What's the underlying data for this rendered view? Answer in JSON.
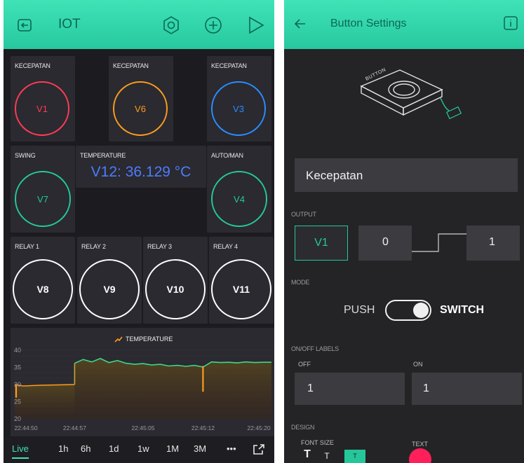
{
  "left": {
    "header": {
      "title": "IOT"
    },
    "widgets": [
      {
        "id": "kec1",
        "label": "KECEPATAN",
        "pin": "V1",
        "color": "#ff3b55"
      },
      {
        "id": "kec2",
        "label": "KECEPATAN",
        "pin": "V6",
        "color": "#ff9a1f"
      },
      {
        "id": "kec3",
        "label": "KECEPATAN",
        "pin": "V3",
        "color": "#2a8cff"
      },
      {
        "id": "swing",
        "label": "SWING",
        "pin": "V7",
        "color": "#25c79a"
      },
      {
        "id": "automan",
        "label": "AUTO/MAN",
        "pin": "V4",
        "color": "#25c79a"
      },
      {
        "id": "r1",
        "label": "RELAY 1",
        "pin": "V8",
        "color": "#ffffff"
      },
      {
        "id": "r2",
        "label": "RELAY 2",
        "pin": "V9",
        "color": "#ffffff"
      },
      {
        "id": "r3",
        "label": "RELAY 3",
        "pin": "V10",
        "color": "#ffffff"
      },
      {
        "id": "r4",
        "label": "RELAY 4",
        "pin": "V11",
        "color": "#ffffff"
      }
    ],
    "temperature_display": {
      "label": "TEMPERATURE",
      "value": "V12: 36.129 °C",
      "color": "#4d7bff"
    },
    "chart_data": {
      "type": "line",
      "title": "TEMPERATURE",
      "x_tick_labels": [
        "22:44:50",
        "22:44:57",
        "22:45:05",
        "22:45:12",
        "22:45:20"
      ],
      "y_tick_labels": [
        "20",
        "25",
        "30",
        "35",
        "40"
      ],
      "ylim": [
        20,
        40
      ],
      "series": [
        {
          "color": "#ff9a1f",
          "x": [
            "22:44:50",
            "22:44:51",
            "22:44:53",
            "22:44:55",
            "22:44:57"
          ],
          "y": [
            30,
            29.6,
            29.8,
            29.9,
            30
          ]
        },
        {
          "color": "#3fd68a",
          "x": [
            "22:44:57",
            "22:44:58",
            "22:44:59",
            "22:45:00",
            "22:45:01",
            "22:45:02",
            "22:45:03",
            "22:45:04",
            "22:45:05",
            "22:45:06",
            "22:45:07",
            "22:45:08",
            "22:45:09",
            "22:45:10",
            "22:45:11",
            "22:45:12",
            "22:45:13",
            "22:45:14",
            "22:45:15",
            "22:45:16",
            "22:45:17",
            "22:45:18",
            "22:45:19",
            "22:45:20"
          ],
          "y": [
            36.2,
            37.3,
            36.6,
            37.6,
            36.4,
            37.0,
            36.2,
            35.9,
            36.1,
            35.7,
            35.9,
            35.4,
            35.6,
            35.3,
            35.6,
            35.1,
            36.6,
            36.4,
            36.5,
            36.3,
            36.6,
            36.4,
            36.5,
            36.5
          ]
        }
      ],
      "dips": [
        {
          "x": "22:44:50",
          "y": 26.2
        },
        {
          "x": "22:45:12",
          "y": 27.9
        }
      ]
    },
    "ranges": [
      "Live",
      "1h",
      "6h",
      "1d",
      "1w",
      "1M",
      "3M",
      "•••"
    ],
    "active_range": "Live"
  },
  "right": {
    "header": {
      "title": "Button Settings"
    },
    "illustration_caption": "BUTTON",
    "name_value": "Kecepatan",
    "output": {
      "label": "OUTPUT",
      "pin": "V1",
      "low": "0",
      "high": "1"
    },
    "mode": {
      "label": "MODE",
      "left": "PUSH",
      "right": "SWITCH"
    },
    "labels": {
      "label": "ON/OFF LABELS",
      "off_label": "OFF",
      "on_label": "ON",
      "off_value": "1",
      "on_value": "1"
    },
    "design": {
      "label": "DESIGN",
      "font_size": "FONT SIZE",
      "text": "TEXT",
      "accent": "#25c79a"
    }
  }
}
